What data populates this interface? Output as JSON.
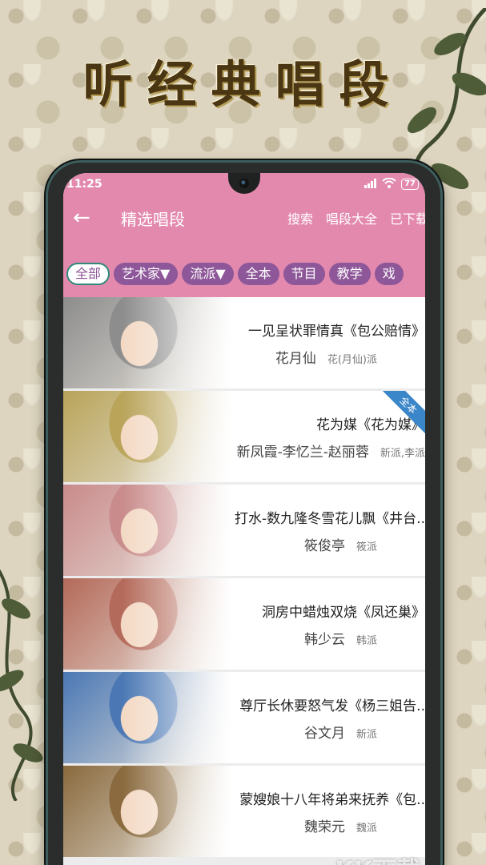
{
  "promo": {
    "headline": "听经典唱段"
  },
  "status": {
    "time": "11:25",
    "battery": "77"
  },
  "appbar": {
    "back_icon": "back-arrow-icon",
    "title": "精选唱段",
    "actions": [
      "搜索",
      "唱段大全",
      "已下载"
    ]
  },
  "chips": [
    "全部",
    "艺术家▼",
    "流派▼",
    "全本",
    "节目",
    "教学",
    "戏"
  ],
  "songs": [
    {
      "title": "一见呈状罪情真《包公赔情》",
      "artist": "花月仙",
      "school": "花(月仙)派",
      "full": false
    },
    {
      "title": "花为媒《花为媒》",
      "artist": "新凤霞-李忆兰-赵丽蓉",
      "school": "新派,李派",
      "full": true
    },
    {
      "title": "打水-数九隆冬雪花儿飘《井台..",
      "artist": "筱俊亭",
      "school": "筱派",
      "full": false
    },
    {
      "title": "洞房中蜡烛双烧《凤还巢》",
      "artist": "韩少云",
      "school": "韩派",
      "full": false
    },
    {
      "title": "尊厅长休要怒气发《杨三姐告..",
      "artist": "谷文月",
      "school": "新派",
      "full": false
    },
    {
      "title": "蒙嫂娘十八年将弟来抚养《包..",
      "artist": "魏荣元",
      "school": "魏派",
      "full": false
    }
  ],
  "ribbon_label": "全本",
  "watermark": "KK下载",
  "thumb_colors": [
    "#8d8d8d",
    "#b9a45a",
    "#c98b8b",
    "#b46a5a",
    "#4b78b4",
    "#8a6a3e"
  ]
}
